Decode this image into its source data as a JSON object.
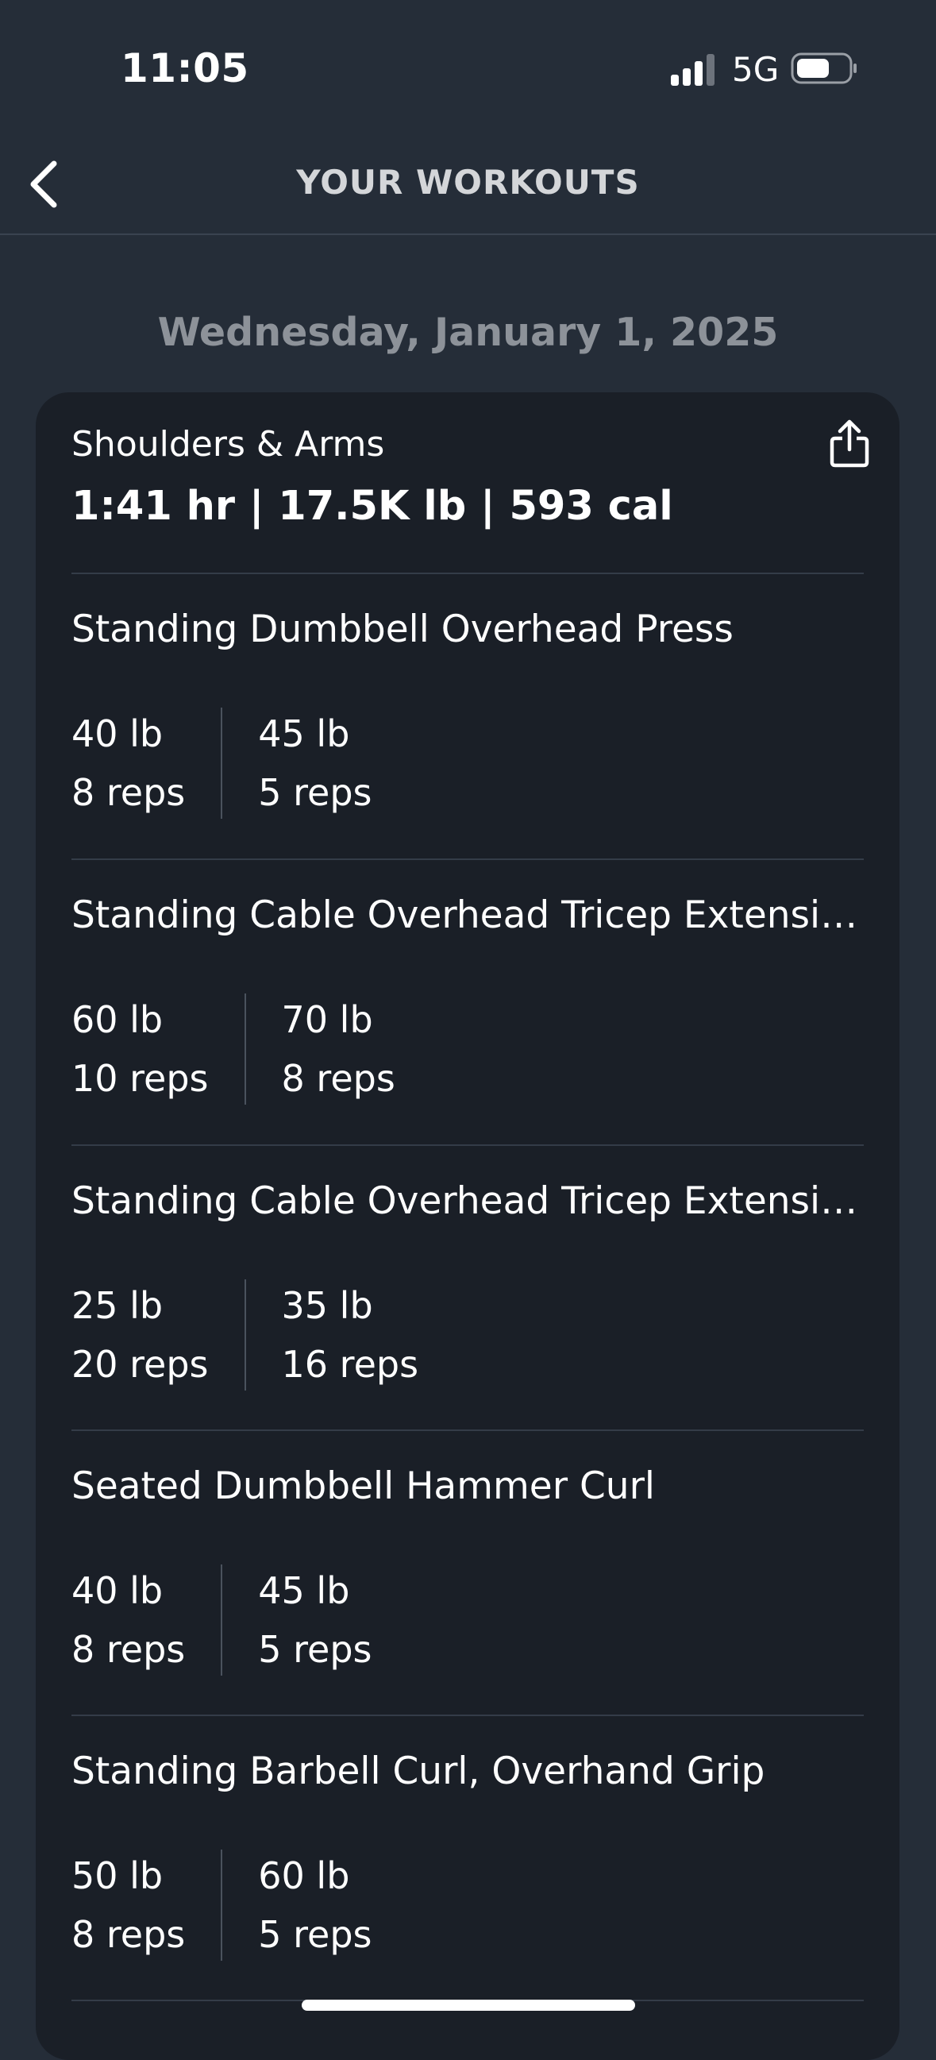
{
  "status_bar": {
    "time": "11:05",
    "network": "5G",
    "icons": [
      "signal-bars-icon",
      "battery-icon"
    ]
  },
  "nav": {
    "title": "YOUR WORKOUTS",
    "back_icon": "chevron-left-icon"
  },
  "date_heading": "Wednesday, January 1, 2025",
  "workout": {
    "name": "Shoulders & Arms",
    "summary": "1:41 hr | 17.5K lb | 593 cal",
    "share_icon": "share-icon",
    "exercises": [
      {
        "title": "Standing Dumbbell Overhead Press",
        "sets": [
          {
            "weight": "40 lb",
            "reps": "8 reps"
          },
          {
            "weight": "45 lb",
            "reps": "5 reps"
          }
        ]
      },
      {
        "title": "Standing Cable Overhead Tricep Extensio⋯",
        "sets": [
          {
            "weight": "60 lb",
            "reps": "10 reps"
          },
          {
            "weight": "70 lb",
            "reps": "8 reps"
          }
        ]
      },
      {
        "title": "Standing Cable Overhead Tricep Extensio⋯",
        "sets": [
          {
            "weight": "25 lb",
            "reps": "20 reps"
          },
          {
            "weight": "35 lb",
            "reps": "16 reps"
          }
        ]
      },
      {
        "title": "Seated Dumbbell Hammer Curl",
        "sets": [
          {
            "weight": "40 lb",
            "reps": "8 reps"
          },
          {
            "weight": "45 lb",
            "reps": "5 reps"
          }
        ]
      },
      {
        "title": "Standing Barbell Curl, Overhand Grip",
        "sets": [
          {
            "weight": "50 lb",
            "reps": "8 reps"
          },
          {
            "weight": "60 lb",
            "reps": "5 reps"
          }
        ]
      }
    ]
  },
  "colors": {
    "background": "#252d38",
    "card": "#1a1f27",
    "muted_text": "#8d9299",
    "nav_title": "#d4d6d9"
  }
}
